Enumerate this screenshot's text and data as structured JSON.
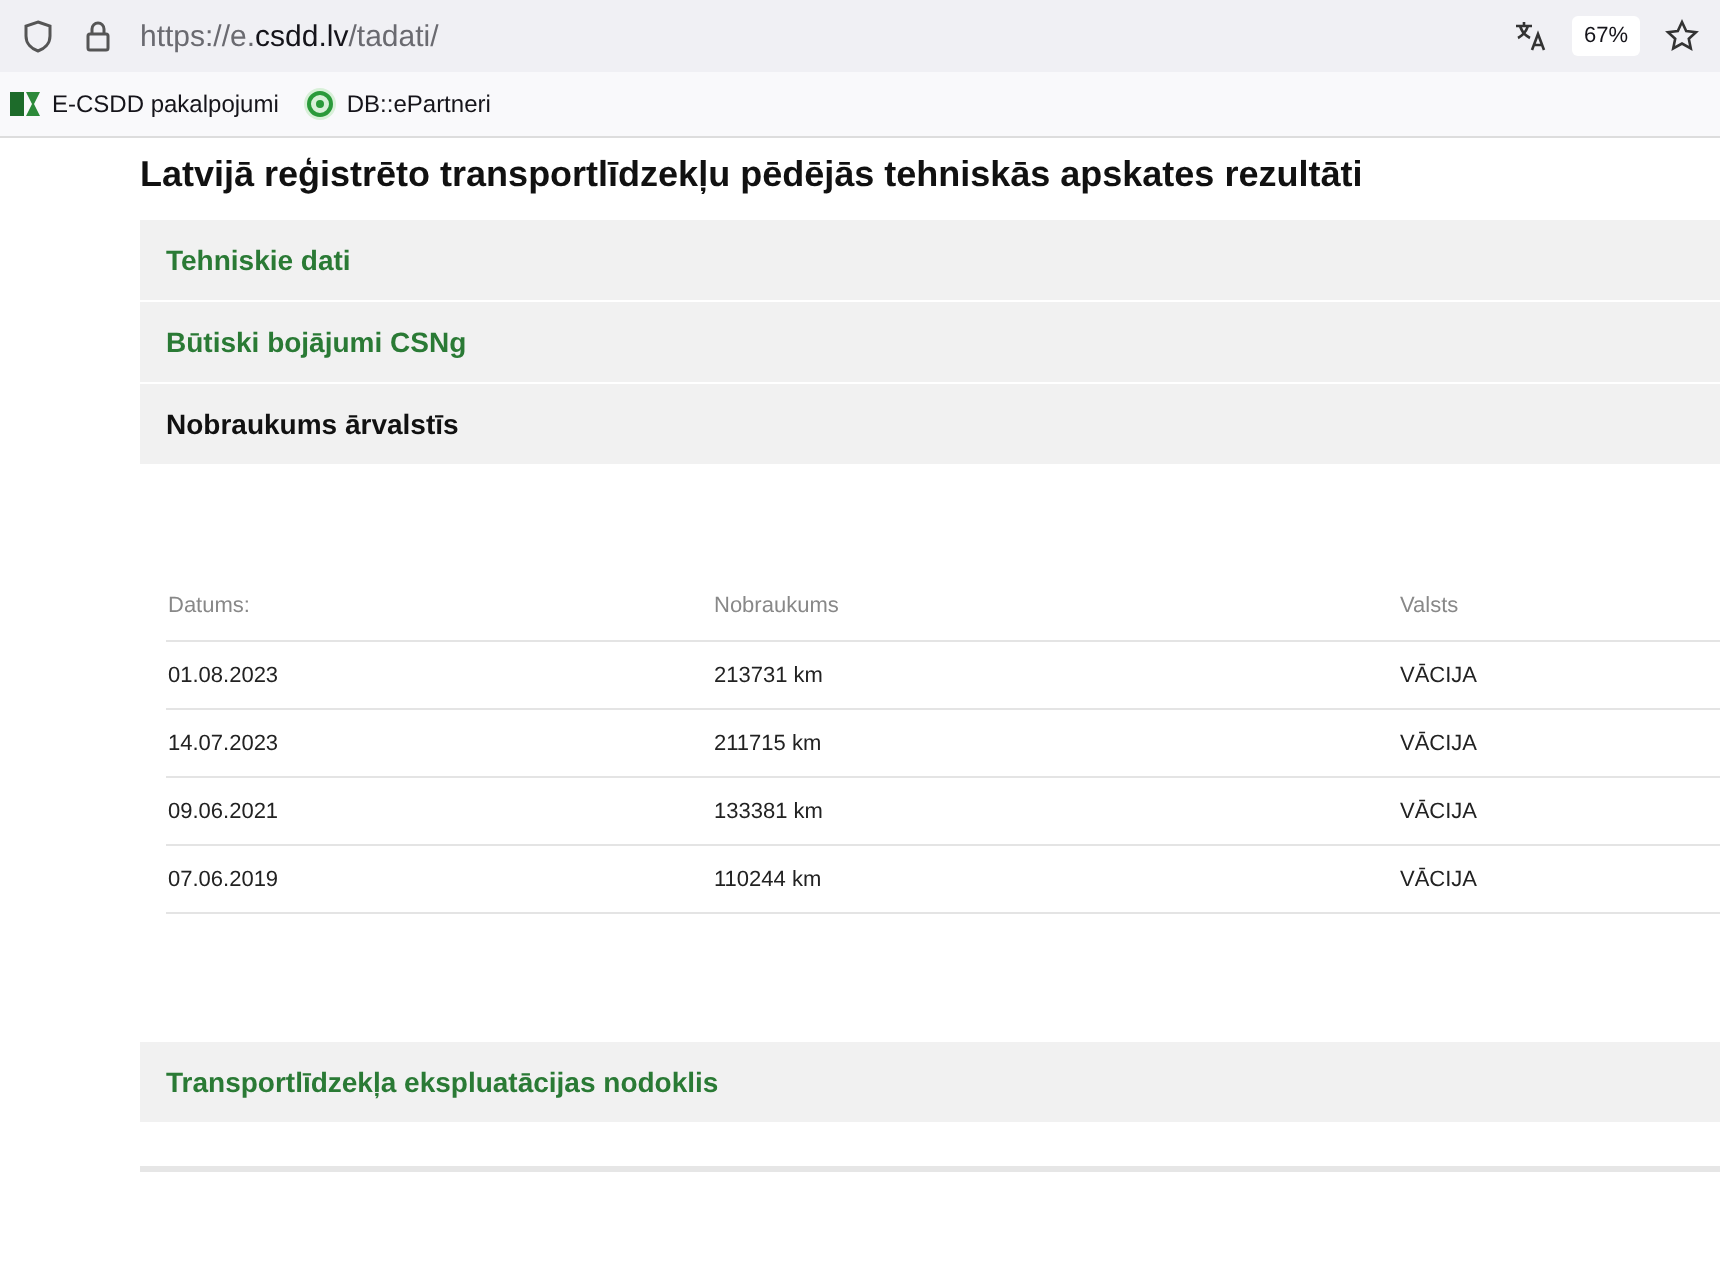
{
  "browser": {
    "url_prefix": "https://e.",
    "url_domain": "csdd.lv",
    "url_path": "/tadati/",
    "zoom": "67%",
    "bookmarks": [
      {
        "label": "E-CSDD pakalpojumi",
        "kind": "csdd"
      },
      {
        "label": "DB::ePartneri",
        "kind": "epartneri"
      }
    ]
  },
  "page_title": "Latvijā reģistrēto transportlīdzekļu pēdējās tehniskās apskates rezultāti",
  "sections": [
    {
      "title": "Tehniskie dati",
      "expanded": false
    },
    {
      "title": "Būtiski bojājumi CSNg",
      "expanded": false
    },
    {
      "title": "Nobraukums ārvalstīs",
      "expanded": true,
      "table": {
        "columns": [
          "Datums:",
          "Nobraukums",
          "Valsts"
        ],
        "rows": [
          [
            "01.08.2023",
            "213731 km",
            "VĀCIJA"
          ],
          [
            "14.07.2023",
            "211715 km",
            "VĀCIJA"
          ],
          [
            "09.06.2021",
            "133381 km",
            "VĀCIJA"
          ],
          [
            "07.06.2019",
            "110244 km",
            "VĀCIJA"
          ]
        ]
      }
    },
    {
      "title": "Transportlīdzekļa ekspluatācijas nodoklis",
      "expanded": false
    }
  ]
}
